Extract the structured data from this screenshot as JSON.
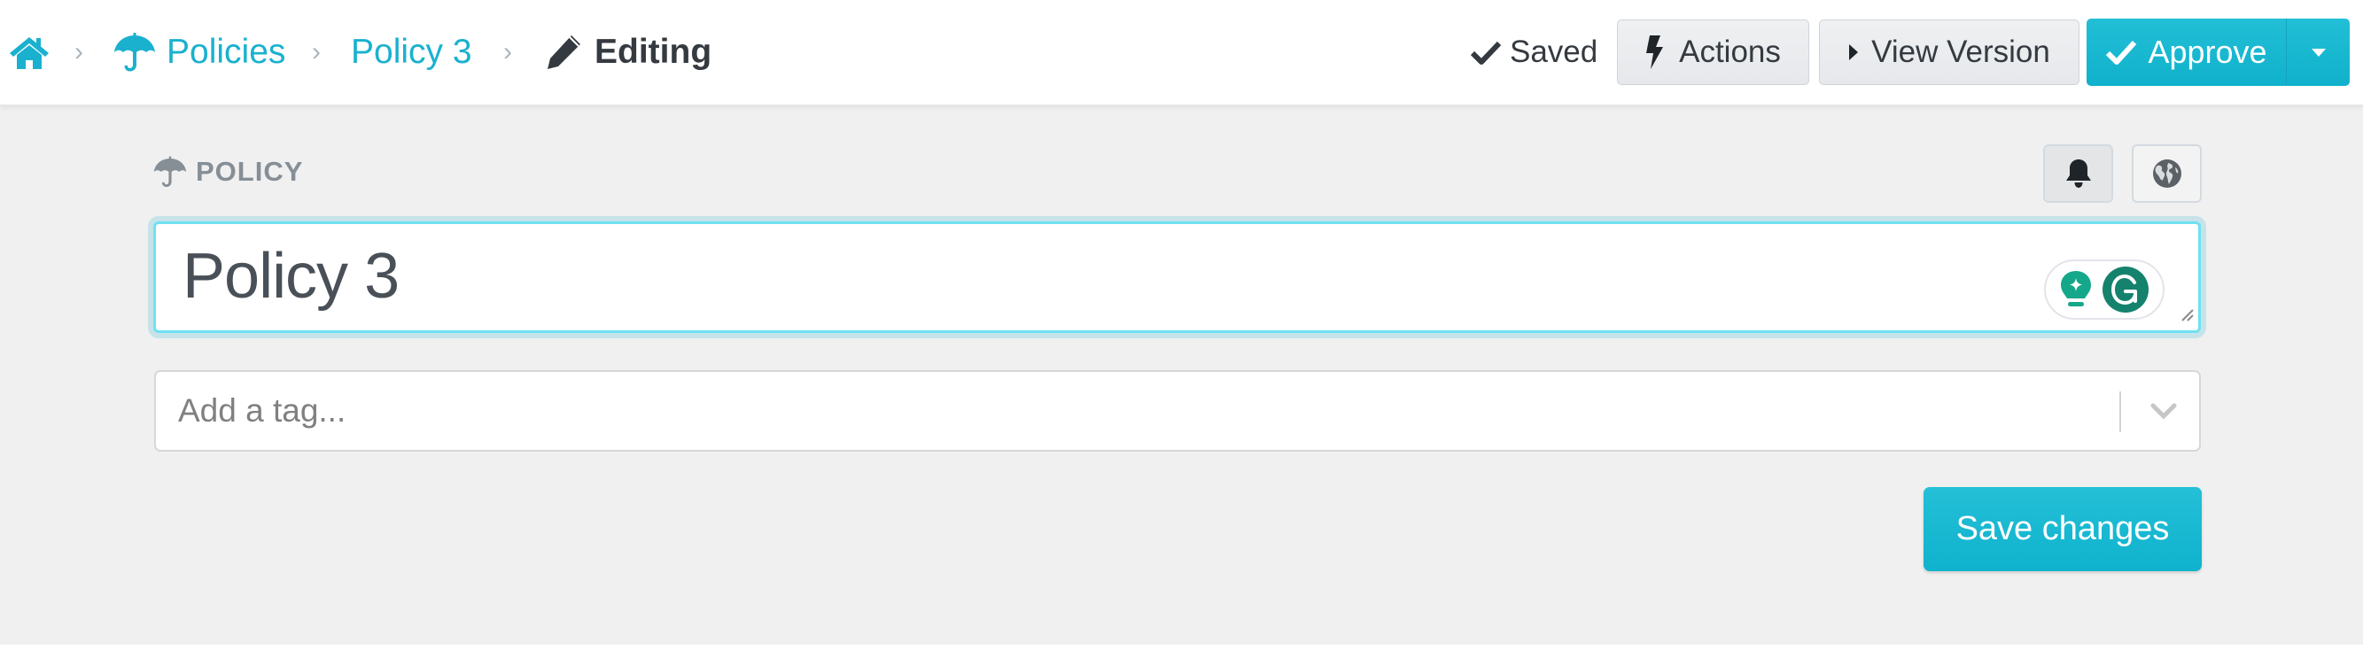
{
  "header": {
    "breadcrumb": {
      "home_icon": "home-icon",
      "separator": "›",
      "items": [
        {
          "icon": "umbrella-icon",
          "label": "Policies"
        },
        {
          "label": "Policy 3"
        },
        {
          "icon": "pencil-icon",
          "label": "Editing"
        }
      ]
    },
    "status": {
      "icon": "check-icon",
      "label": "Saved"
    },
    "buttons": {
      "actions": {
        "icon": "bolt-icon",
        "label": "Actions"
      },
      "view_version": {
        "icon": "caret-right-icon",
        "label": "View Version"
      },
      "approve": {
        "icon": "check-icon",
        "label": "Approve",
        "dropdown_icon": "caret-down-icon"
      }
    }
  },
  "form": {
    "section_label": {
      "icon": "umbrella-icon",
      "label": "POLICY"
    },
    "toolbar": {
      "notifications": {
        "icon": "bell-icon",
        "active": true
      },
      "visibility": {
        "icon": "globe-icon",
        "active": false
      }
    },
    "title": {
      "value": "Policy 3"
    },
    "grammarly": {
      "icons": [
        "lightbulb-icon",
        "grammarly-icon"
      ]
    },
    "tags": {
      "placeholder": "Add a tag..."
    },
    "save_label": "Save changes"
  },
  "colors": {
    "accent": "#1ab1cf",
    "header_bg": "#ffffff",
    "page_bg": "#f0f0f0",
    "text_dark": "#343a40",
    "muted": "#868e96",
    "grammarly_green": "#15826d"
  }
}
